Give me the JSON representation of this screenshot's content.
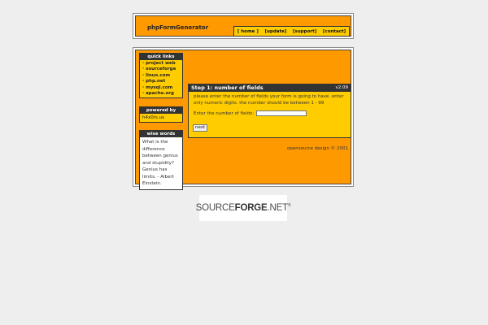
{
  "header": {
    "brand": "phpFormGenerator",
    "nav": [
      "[ home ]",
      "[update]",
      "[support]",
      "[contact]"
    ]
  },
  "sidebar": {
    "quick_links_title": "quick links",
    "quick_links": [
      "project web",
      "sourceforge",
      "linux.com",
      "php.net",
      "mysql.com",
      "apache.org"
    ],
    "powered_title": "powered by",
    "powered_text": "h4x0rs.us",
    "wise_title": "wise words",
    "wise_text": "What is the difference between genius and stupidity? Genius has limits. - Albert Einstein."
  },
  "step": {
    "title": "Step 1: number of fields",
    "version": "v2.09",
    "description": "please enter the number of fields your form is going to have. enter only numeric digits. the number should be between 1 - 99",
    "field_label": "Enter the number of fields:",
    "field_value": "",
    "next_label": "next"
  },
  "footer": "opensource design © 2001",
  "badge": {
    "part1": "SOURCE",
    "part2": "FORGE",
    "part3": ".NET",
    "mark": "®"
  }
}
